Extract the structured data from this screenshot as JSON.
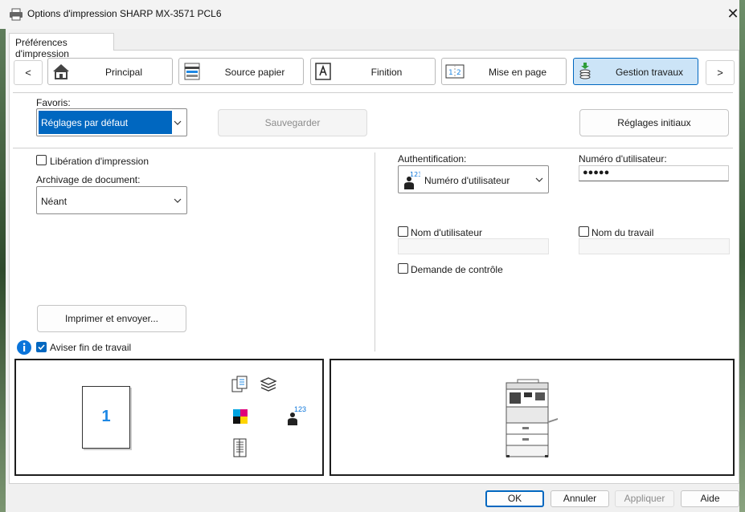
{
  "window": {
    "title": "Options d'impression SHARP MX-3571 PCL6"
  },
  "tab": {
    "label": "Préférences d'impression"
  },
  "nav": {
    "prev": "<",
    "next": ">",
    "items": [
      {
        "label": "Principal",
        "icon": "home-icon"
      },
      {
        "label": "Source papier",
        "icon": "paper-tray-icon"
      },
      {
        "label": "Finition",
        "icon": "finishing-icon"
      },
      {
        "label": "Mise en page",
        "icon": "layout-icon"
      },
      {
        "label": "Gestion travaux",
        "icon": "job-stack-icon",
        "active": true
      }
    ]
  },
  "favorites": {
    "label": "Favoris:",
    "value": "Réglages par défaut",
    "save": "Sauvegarder",
    "reset": "Réglages initiaux"
  },
  "left": {
    "print_release": "Libération d'impression",
    "doc_archive_label": "Archivage de document:",
    "doc_archive_value": "Néant",
    "print_send": "Imprimer et envoyer...",
    "notify_end": "Aviser fin de travail"
  },
  "right": {
    "auth_label": "Authentification:",
    "auth_value": "Numéro d'utilisateur",
    "user_number_label": "Numéro d'utilisateur:",
    "user_number_value": "●●●●●",
    "user_name": "Nom d'utilisateur",
    "job_name": "Nom du travail",
    "check_request": "Demande de contrôle"
  },
  "preview": {
    "page_number": "1",
    "auth_badge": "123"
  },
  "footer": {
    "ok": "OK",
    "cancel": "Annuler",
    "apply": "Appliquer",
    "help": "Aide"
  },
  "colors": {
    "accent": "#0067c0",
    "active_tab": "#cce4f7",
    "info": "#0a74da"
  }
}
